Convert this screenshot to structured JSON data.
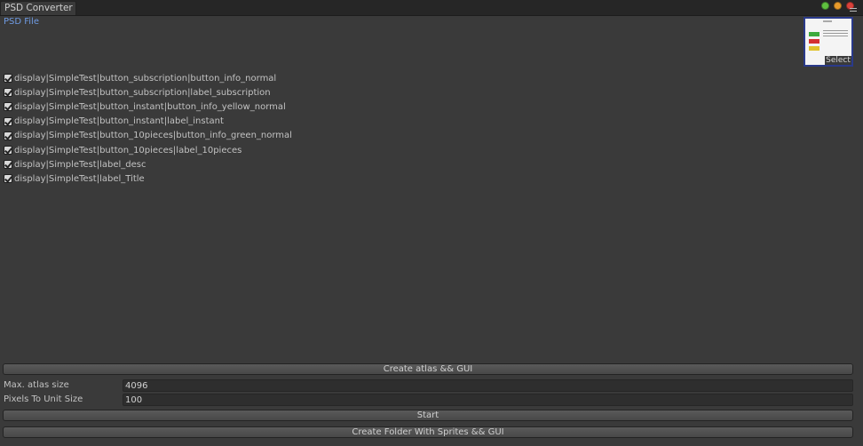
{
  "window": {
    "tab_title": "PSD Converter"
  },
  "psd_file": {
    "label": "PSD File",
    "thumbnail_button": "Select"
  },
  "layers": [
    {
      "label": "display|SimpleTest|button_subscription|button_info_normal",
      "checked": true
    },
    {
      "label": "display|SimpleTest|button_subscription|label_subscription",
      "checked": true
    },
    {
      "label": "display|SimpleTest|button_instant|button_info_yellow_normal",
      "checked": true
    },
    {
      "label": "display|SimpleTest|button_instant|label_instant",
      "checked": true
    },
    {
      "label": "display|SimpleTest|button_10pieces|button_info_green_normal",
      "checked": true
    },
    {
      "label": "display|SimpleTest|button_10pieces|label_10pieces",
      "checked": true
    },
    {
      "label": "display|SimpleTest|label_desc",
      "checked": true
    },
    {
      "label": "display|SimpleTest|label_Title",
      "checked": true
    }
  ],
  "actions": {
    "create_atlas_label": "Create atlas && GUI",
    "start_label": "Start",
    "create_folder_label": "Create Folder With Sprites && GUI"
  },
  "settings": {
    "max_atlas_label": "Max. atlas size",
    "max_atlas_value": "4096",
    "pixels_to_unit_label": "Pixels To Unit Size",
    "pixels_to_unit_value": "100"
  },
  "colors": {
    "background": "#3a3a3a",
    "link_blue": "#6f9be3",
    "close_red": "#d9413a",
    "minimize_orange": "#e89a2b",
    "maximize_green": "#5fbf3f"
  }
}
